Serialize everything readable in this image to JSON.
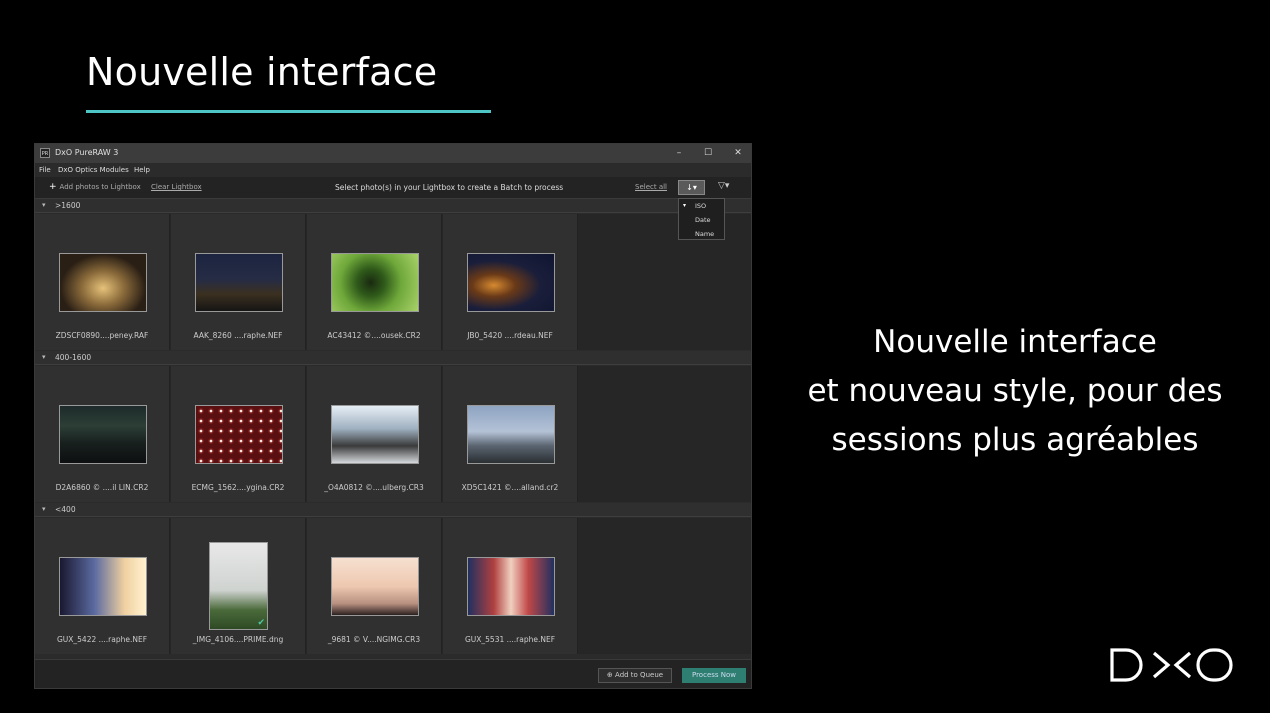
{
  "slide": {
    "title": "Nouvelle interface",
    "accent_color": "#4fc6c6",
    "description_lines": [
      "Nouvelle interface",
      "et nouveau style, pour des",
      "sessions plus agréables"
    ],
    "logo_icon": "dxo-logo"
  },
  "app": {
    "title": "DxO PureRAW 3",
    "icon_text": "PR",
    "window_controls": {
      "minimize": "–",
      "maximize": "☐",
      "close": "✕"
    },
    "menu": [
      "File",
      "DxO Optics Modules",
      "Help"
    ],
    "toolbar": {
      "add_label": "Add photos to Lightbox",
      "add_icon": "+",
      "clear_label": "Clear Lightbox",
      "instruction": "Select photo(s) in your Lightbox to create a Batch to process",
      "select_all": "Select all",
      "sort_icon": "↓▾",
      "filter_icon": "▽▾"
    },
    "sort_menu": {
      "checked_mark": "▾",
      "options": [
        "ISO",
        "Date",
        "Name"
      ]
    },
    "sections": [
      {
        "label": ">1600",
        "photos": [
          "ZDSCF0890....peney.RAF",
          "AAK_8260 ....raphe.NEF",
          "AC43412 ©....ousek.CR2",
          "JB0_5420 ....rdeau.NEF"
        ]
      },
      {
        "label": "400-1600",
        "photos": [
          "D2A6860 © ....il LIN.CR2",
          "ECMG_1562....ygina.CR2",
          "_O4A0812 ©....ulberg.CR3",
          "XD5C1421 ©....alland.cr2"
        ]
      },
      {
        "label": "<400",
        "photos": [
          "GUX_5422 ....raphe.NEF",
          "_IMG_4106....PRIME.dng",
          "_9681 © V....NGIMG.CR3",
          "GUX_5531 ....raphe.NEF"
        ]
      }
    ],
    "footer": {
      "add_queue": "Add to Queue",
      "process_now": "Process Now",
      "process_color": "#2e7e72"
    }
  }
}
